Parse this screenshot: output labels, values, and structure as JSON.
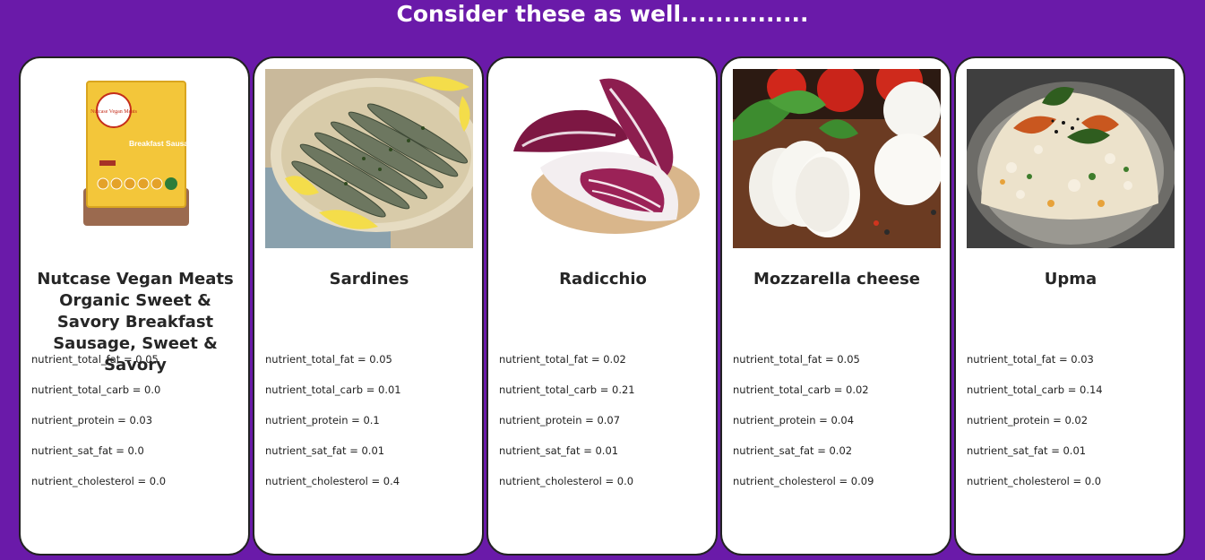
{
  "page": {
    "title": "Consider these as well..............."
  },
  "cards": [
    {
      "name": "Nutcase Vegan Meats Organic Sweet & Savory Breakfast Sausage, Sweet & Savory",
      "image_icon": "breakfast-sausage-package-image",
      "package_brand": "Nutcase Vegan Meats",
      "package_label": "Breakfast Sausage",
      "nutrients": [
        {
          "label": "nutrient_total_fat = 0.05"
        },
        {
          "label": "nutrient_total_carb = 0.0"
        },
        {
          "label": "nutrient_protein = 0.03"
        },
        {
          "label": "nutrient_sat_fat = 0.0"
        },
        {
          "label": "nutrient_cholesterol = 0.0"
        }
      ]
    },
    {
      "name": "Sardines",
      "image_icon": "sardines-plate-image",
      "nutrients": [
        {
          "label": "nutrient_total_fat = 0.05"
        },
        {
          "label": "nutrient_total_carb = 0.01"
        },
        {
          "label": "nutrient_protein = 0.1"
        },
        {
          "label": "nutrient_sat_fat = 0.01"
        },
        {
          "label": "nutrient_cholesterol = 0.4"
        }
      ]
    },
    {
      "name": "Radicchio",
      "image_icon": "radicchio-image",
      "nutrients": [
        {
          "label": "nutrient_total_fat = 0.02"
        },
        {
          "label": "nutrient_total_carb = 0.21"
        },
        {
          "label": "nutrient_protein = 0.07"
        },
        {
          "label": "nutrient_sat_fat = 0.01"
        },
        {
          "label": "nutrient_cholesterol = 0.0"
        }
      ]
    },
    {
      "name": "Mozzarella cheese",
      "image_icon": "mozzarella-image",
      "nutrients": [
        {
          "label": "nutrient_total_fat = 0.05"
        },
        {
          "label": "nutrient_total_carb = 0.02"
        },
        {
          "label": "nutrient_protein = 0.04"
        },
        {
          "label": "nutrient_sat_fat = 0.02"
        },
        {
          "label": "nutrient_cholesterol = 0.09"
        }
      ]
    },
    {
      "name": "Upma",
      "image_icon": "upma-image",
      "nutrients": [
        {
          "label": "nutrient_total_fat = 0.03"
        },
        {
          "label": "nutrient_total_carb = 0.14"
        },
        {
          "label": "nutrient_protein = 0.02"
        },
        {
          "label": "nutrient_sat_fat = 0.01"
        },
        {
          "label": "nutrient_cholesterol = 0.0"
        }
      ]
    }
  ],
  "colors": {
    "page_background": "#6a1aa9",
    "card_background": "#ffffff",
    "card_border": "#222222",
    "title_text": "#ffffff",
    "body_text": "#222222"
  }
}
